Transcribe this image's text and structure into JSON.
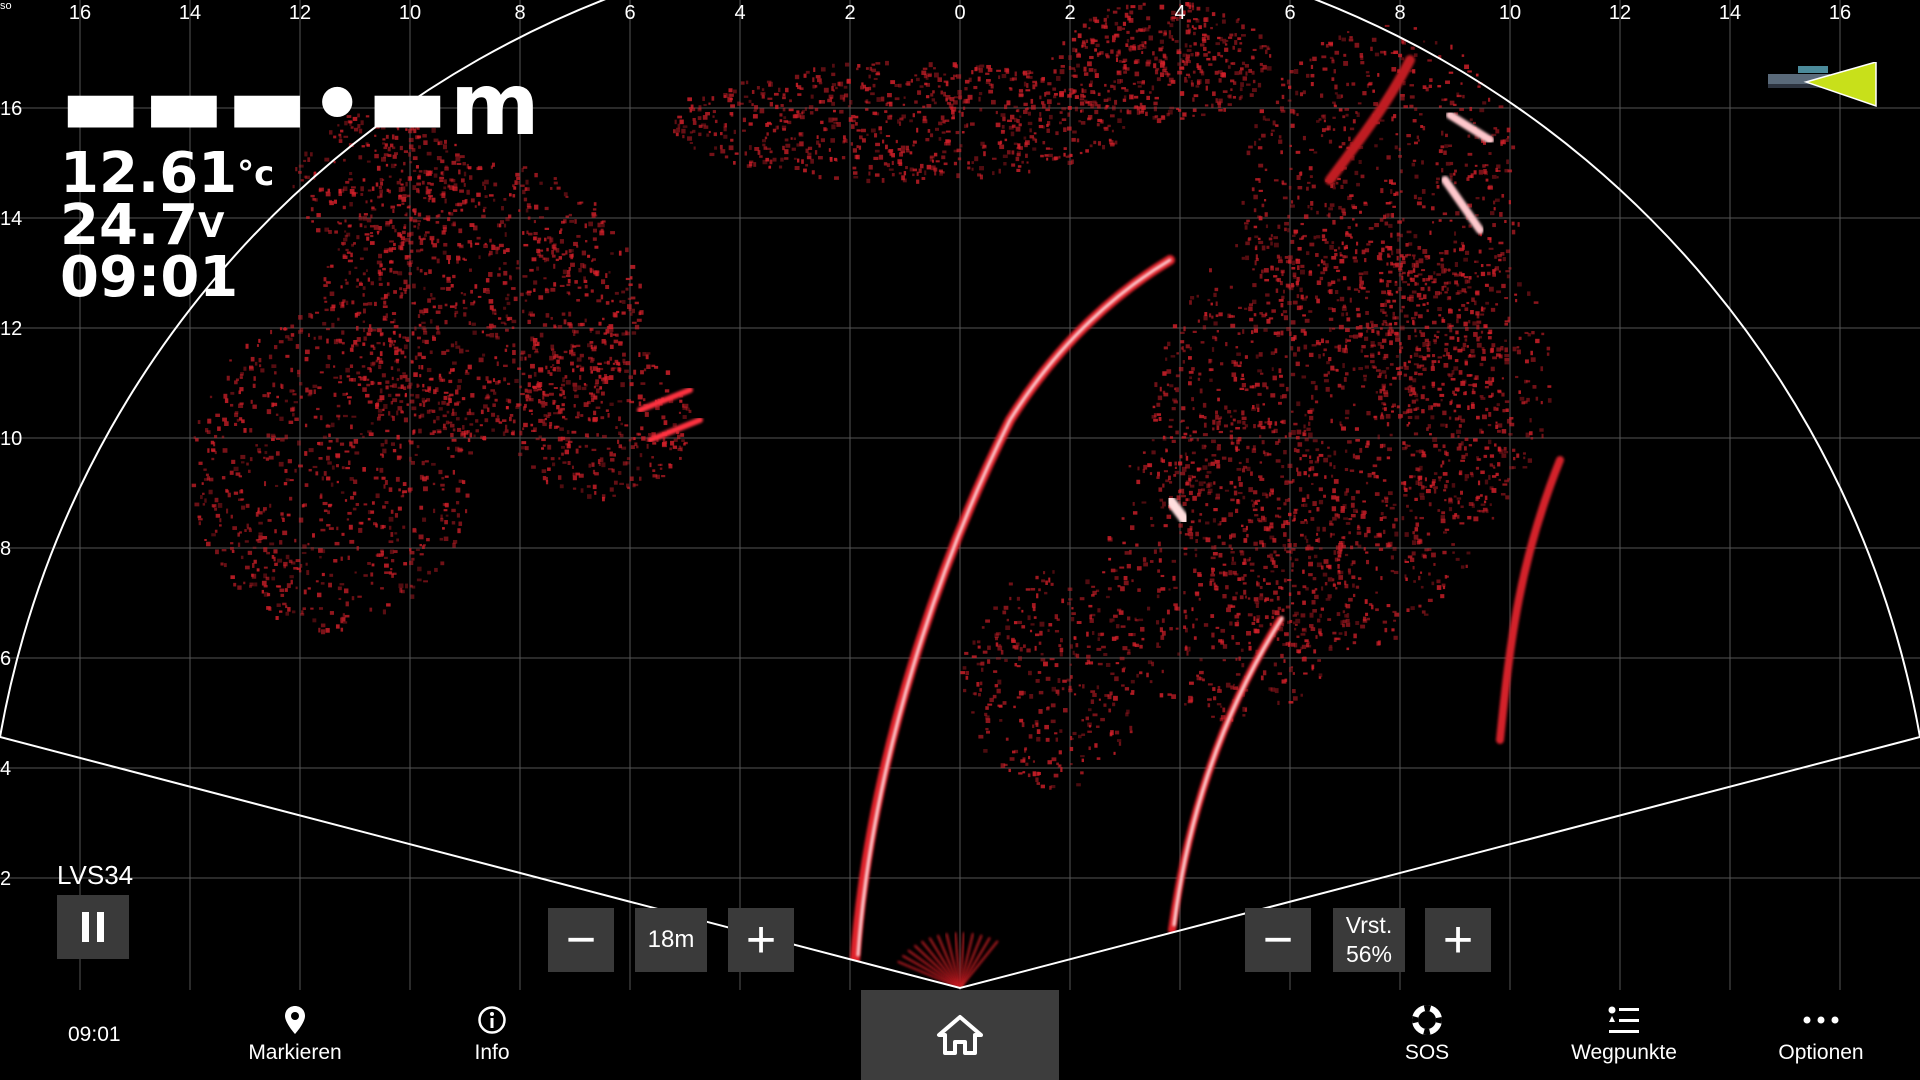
{
  "colors": {
    "accent": "#d4202a",
    "background": "#000000",
    "control_bg": "#3a3a3a",
    "home_bg": "#3d3d3d"
  },
  "axis": {
    "top_labels": [
      "16",
      "14",
      "12",
      "10",
      "8",
      "6",
      "4",
      "2",
      "0",
      "2",
      "4",
      "6",
      "8",
      "10",
      "12",
      "14",
      "16"
    ],
    "left_labels": [
      "16",
      "14",
      "12",
      "10",
      "8",
      "6",
      "4",
      "2"
    ],
    "corner_label": "so"
  },
  "readout": {
    "depth": "▬▬▬•▬m",
    "temperature": "12.61",
    "temperature_unit": "°c",
    "voltage": "24.7",
    "voltage_unit": "V",
    "time": "09:01"
  },
  "source": {
    "label": "LVS34"
  },
  "range": {
    "minus": "−",
    "value": "18m",
    "plus": "+"
  },
  "gain": {
    "label": "Vrst.",
    "value": "56%",
    "minus": "−",
    "plus": "+"
  },
  "bottom_bar": {
    "clock": "09:01",
    "items": [
      {
        "label": "Markieren",
        "icon": "map-pin-icon"
      },
      {
        "label": "Info",
        "icon": "info-icon"
      },
      {
        "label": "",
        "icon": "home-icon"
      },
      {
        "label": "SOS",
        "icon": "lifebuoy-icon"
      },
      {
        "label": "Wegpunkte",
        "icon": "waypoints-list-icon"
      },
      {
        "label": "Optionen",
        "icon": "more-icon"
      }
    ]
  }
}
